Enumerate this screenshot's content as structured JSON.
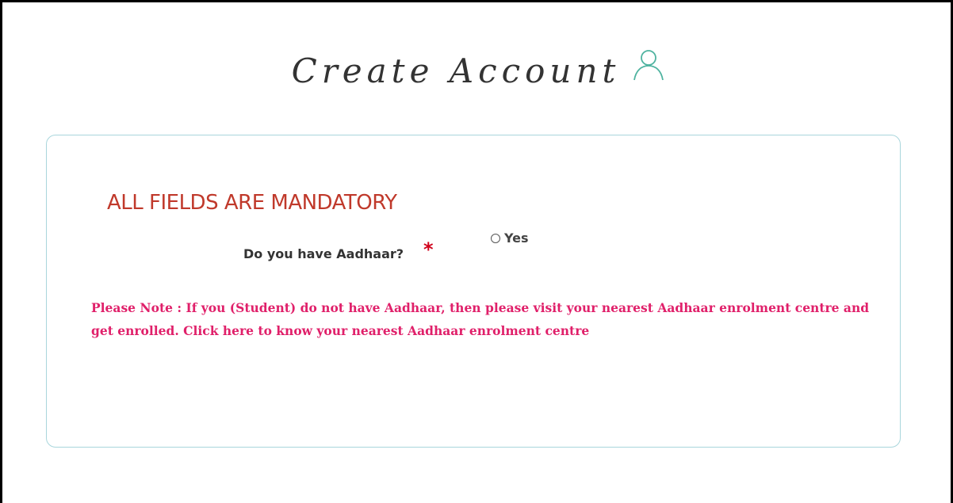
{
  "page": {
    "title": "Create Account",
    "title_icon": "user-outline-icon"
  },
  "form": {
    "mandatory_notice": "ALL FIELDS ARE MANDATORY",
    "aadhaar_question": "Do you have Aadhaar?",
    "required_marker": "*",
    "aadhaar_option_yes": "Yes",
    "note_prefix": "Please Note : If you (Student) do not have Aadhaar, then please visit your nearest Aadhaar enrolment centre and get enrolled. ",
    "note_link": "Click here to know your nearest Aadhaar enrolment centre"
  },
  "colors": {
    "mandatory": "#c0392b",
    "note": "#e0206a",
    "required_star": "#d0021b",
    "icon": "#4fb3a0",
    "card_border": "#a9d6dc"
  }
}
